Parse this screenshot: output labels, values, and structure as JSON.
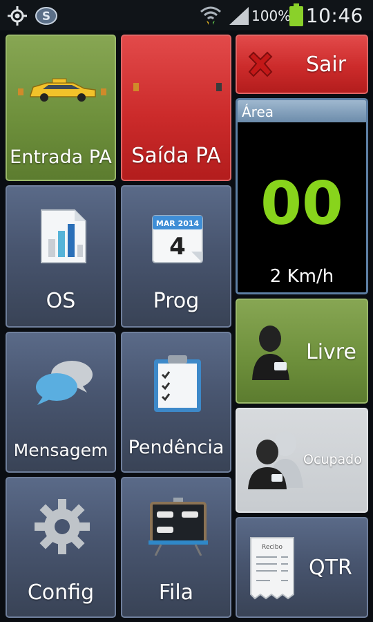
{
  "status_bar": {
    "battery_percent": "100%",
    "time": "10:46",
    "icons": [
      "gps-icon",
      "app-s-icon",
      "wifi-icon",
      "signal-icon",
      "battery-icon"
    ]
  },
  "tiles": {
    "entrada": {
      "label": "Entrada PA",
      "color": "#6d8f3b"
    },
    "saida": {
      "label": "Saída PA",
      "color": "#cc2b2b"
    },
    "sair": {
      "label": "Sair",
      "color": "#cc2b2b"
    },
    "os": {
      "label": "OS"
    },
    "prog": {
      "label": "Prog",
      "calendar_month": "MAR 2014",
      "calendar_day": "4"
    },
    "mensagem": {
      "label": "Mensagem"
    },
    "pendencia": {
      "label": "Pendência"
    },
    "config": {
      "label": "Config"
    },
    "fila": {
      "label": "Fila"
    },
    "livre": {
      "label": "Livre",
      "color": "#6d8f3b"
    },
    "ocupado": {
      "label": "Ocupado"
    },
    "qtr": {
      "label": "QTR",
      "receipt_title": "Recibo"
    }
  },
  "area_panel": {
    "header": "Área",
    "value": "00",
    "speed": "2 Km/h",
    "value_color": "#88d41c"
  }
}
